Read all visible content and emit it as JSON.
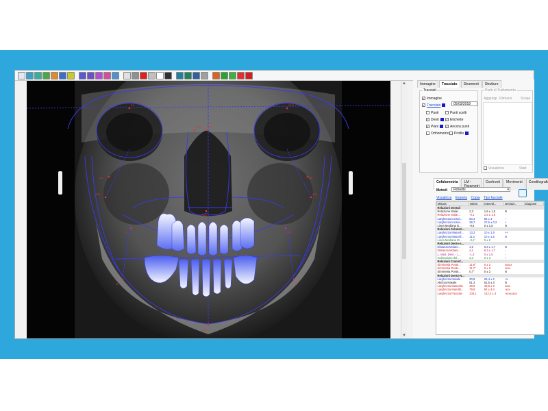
{
  "panel": {
    "top_tabs": [
      "Immagine",
      "Tracciato",
      "Strumenti",
      "Strutture"
    ],
    "tracciati": {
      "title": "Tracciati",
      "immagine": "Immagine",
      "tracciato": "Tracciato",
      "date": "05/03/2018",
      "punti": "Punti",
      "punti_scelti": "Punti scelti",
      "denti": "Denti",
      "etichette": "Etichette",
      "piani": "Piani",
      "ancora_punti": "Ancora punti",
      "ortho_metrica": "Orthometrica",
      "profilo": "Profilo"
    },
    "punti_tratt": {
      "title": "Punti di Trattamento",
      "cols": [
        "Aggiungi",
        "Rimuovi",
        "Scopa"
      ],
      "bottom_left": "Visualizza",
      "bottom_right": "Start"
    },
    "bottom_tabs": [
      "Cefalometria",
      "LM - Parametri",
      "Confronti",
      "Movimenti",
      "Condilografia"
    ],
    "metodi_label": "Metodi",
    "metodi_value": "Ricketts",
    "links": [
      "Visualizza",
      "Esporta",
      "Copia",
      "Tipo facciale"
    ],
    "columns": [
      "Misura",
      "Valore",
      "Interval...",
      "Deviazi...",
      "Diagnosi"
    ],
    "rows": [
      {
        "type": "section",
        "cells": [
          "Relazioni Dentali",
          "",
          "",
          "",
          ""
        ]
      },
      {
        "type": "row",
        "color": "c-black",
        "cells": [
          "Relazione Molar...",
          "2,3",
          "1,5 ± 1,5",
          "N",
          ""
        ]
      },
      {
        "type": "row",
        "color": "c-red",
        "cells": [
          "Relazione Molar...",
          "-0,1",
          "1,5 ± 1,5",
          "-",
          ""
        ]
      },
      {
        "type": "row",
        "color": "c-blue",
        "cells": [
          "Larghezza Incisivi...",
          "50,3",
          "55 ± 3",
          "--",
          ""
        ]
      },
      {
        "type": "row",
        "color": "c-blue",
        "cells": [
          "Larghezza Incisivi...",
          "38,7",
          "27,5 ± 0,2",
          "+",
          ""
        ]
      },
      {
        "type": "row",
        "color": "c-black",
        "cells": [
          "Linea Mediana D...",
          "-0,6",
          "0 ± 1,5",
          "N",
          ""
        ]
      },
      {
        "type": "section",
        "cells": [
          "Relazioni Scheletr...",
          "",
          "",
          "",
          ""
        ]
      },
      {
        "type": "row",
        "color": "c-blue",
        "cells": [
          "Larghezza Mascell...",
          "13,2",
          "10 ± 1,5",
          "++",
          ""
        ]
      },
      {
        "type": "row",
        "color": "c-blue",
        "cells": [
          "Larghezza Mascell...",
          "11,2",
          "10 ± 1,5",
          "N",
          ""
        ]
      },
      {
        "type": "row",
        "color": "c-green",
        "cells": [
          "Linea Mediana M...",
          "-3,1°",
          "0 ± 2",
          "-",
          ""
        ]
      },
      {
        "type": "section",
        "cells": [
          "Relazioni Dento-s...",
          "",
          "",
          "",
          ""
        ]
      },
      {
        "type": "row",
        "color": "c-blue",
        "cells": [
          "Distanza Molare...",
          "4,6",
          "6,3 ± 1,7",
          "N",
          ""
        ]
      },
      {
        "type": "row",
        "color": "c-red",
        "cells": [
          "Distanza Molare...",
          "4,1",
          "6,3 ± 1,7",
          "-",
          ""
        ]
      },
      {
        "type": "row",
        "color": "c-magenta",
        "cells": [
          "L. Med. Dent. - L...",
          "-1,3",
          "0 ± 1,5",
          "-",
          ""
        ]
      },
      {
        "type": "row",
        "color": "c-green",
        "cells": [
          "Inclinazione del...",
          "2,3",
          "0 ± 3",
          "+",
          ""
        ]
      },
      {
        "type": "section",
        "cells": [
          "Relazioni Craniof...",
          "",
          "",
          "",
          ""
        ]
      },
      {
        "type": "row",
        "color": "c-red",
        "cells": [
          "Simmetria Poste...",
          "11,9°",
          "0 ± 2",
          "xxxxx",
          ""
        ]
      },
      {
        "type": "row",
        "color": "c-red",
        "cells": [
          "Simmetria Poste...",
          "11,7°",
          "0 ± 2",
          "xxxx",
          ""
        ]
      },
      {
        "type": "row",
        "color": "c-black",
        "cells": [
          "Simmetria Poste...",
          "0,7°",
          "0 ± 2",
          "N",
          ""
        ]
      },
      {
        "type": "section",
        "cells": [
          "Relazioni Dento-N...",
          "",
          "",
          "",
          ""
        ]
      },
      {
        "type": "row",
        "color": "c-blue",
        "cells": [
          "Larghezza Nasale",
          "30,8",
          "26,4 ± 2",
          "+x",
          ""
        ]
      },
      {
        "type": "row",
        "color": "c-black",
        "cells": [
          "Altezza Nasale",
          "51,3",
          "51,5 ± 3",
          "N",
          ""
        ]
      },
      {
        "type": "row",
        "color": "c-red",
        "cells": [
          "Larghezza Mascella",
          "49,8",
          "46,8 ± 2",
          "xxxx",
          ""
        ]
      },
      {
        "type": "row",
        "color": "c-red",
        "cells": [
          "Larghezza Mandib...",
          "79,8",
          "84 ± 3,4",
          "-xxx",
          ""
        ]
      },
      {
        "type": "row",
        "color": "c-red",
        "cells": [
          "Larghezza Facciale",
          "105,1",
          "142,4 ± 3",
          "-xxxxxxxx",
          ""
        ]
      }
    ]
  },
  "point_labels": [
    "ZA",
    "CNL",
    "CNL",
    "ZYG",
    "AGL",
    "AGL",
    "ANS",
    "M",
    "M",
    "Go",
    "Go",
    "ME",
    "S",
    "ZA"
  ]
}
